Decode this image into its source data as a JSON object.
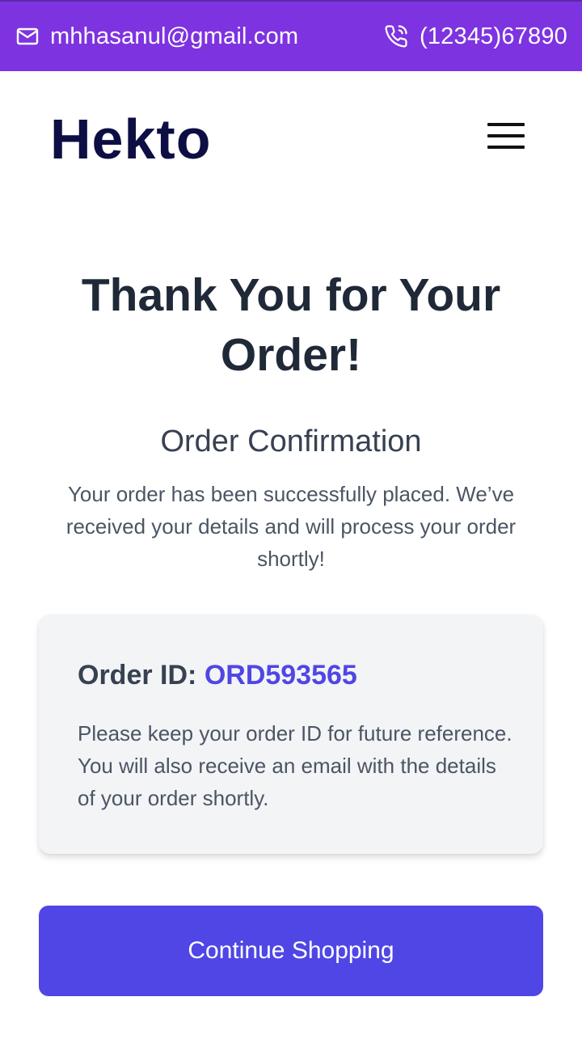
{
  "topbar": {
    "email": "mhhasanul@gmail.com",
    "phone": "(12345)67890",
    "email_icon": "mail-icon",
    "phone_icon": "phone-call-icon",
    "background": "#7e33e0"
  },
  "header": {
    "logo": "Hekto",
    "menu_icon": "hamburger-menu-icon"
  },
  "main": {
    "title": "Thank You for Your Order!",
    "subtitle": "Order Confirmation",
    "message": "Your order has been successfully placed. We’ve received your details and will process your order shortly!",
    "order": {
      "label": "Order ID:",
      "id": "ORD593565",
      "note": "Please keep your order ID for future reference. You will also receive an email with the details of your order shortly."
    },
    "continue_label": "Continue Shopping"
  },
  "colors": {
    "accent": "#4f46e5",
    "logo": "#0d0e43",
    "heading": "#1f2937"
  }
}
